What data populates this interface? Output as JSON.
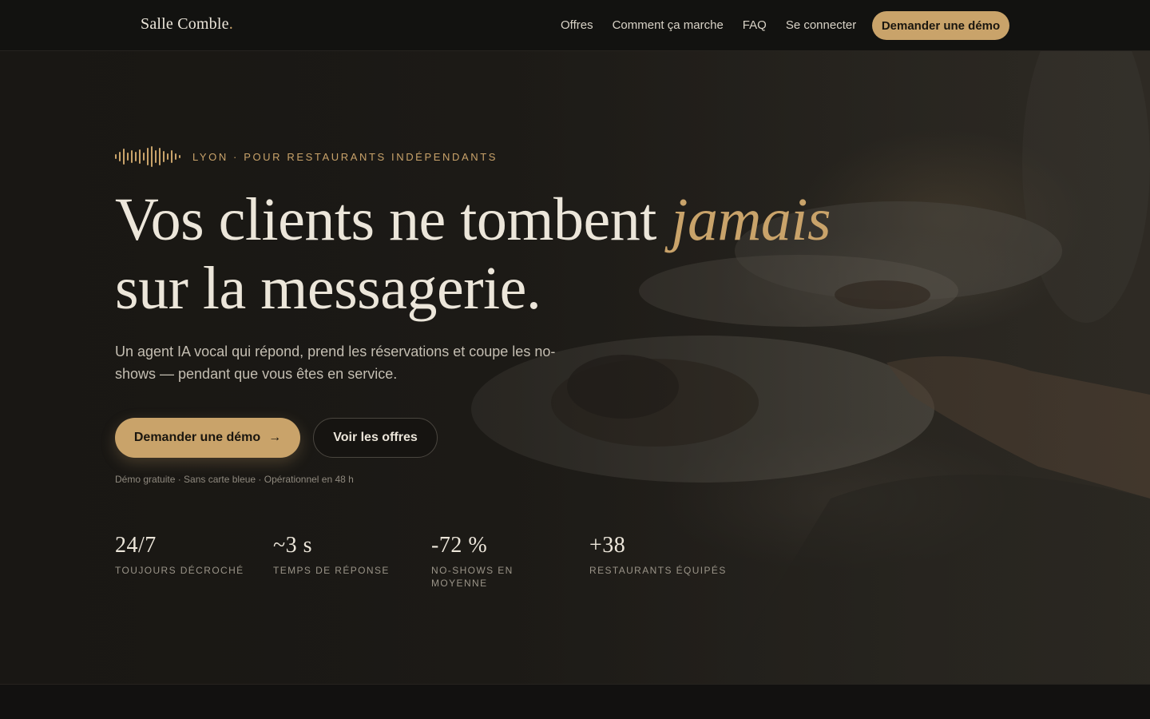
{
  "header": {
    "logo_text": "Salle Comble",
    "logo_dot": ".",
    "nav": [
      {
        "label": "Offres"
      },
      {
        "label": "Comment ça marche"
      },
      {
        "label": "FAQ"
      },
      {
        "label": "Se connecter"
      }
    ],
    "cta_label": "Demander une démo"
  },
  "hero": {
    "eyebrow": "LYON · POUR RESTAURANTS INDÉPENDANTS",
    "eyebrow_icon": "soundwave-icon",
    "headline_part1": "Vos clients ne tombent ",
    "headline_accent": "jamais",
    "headline_part2": "sur la messagerie.",
    "subtitle": "Un agent IA vocal qui répond, prend les réservations et coupe les no-shows — pendant que vous êtes en service.",
    "primary_cta": "Demander une démo",
    "primary_cta_icon": "arrow-right-icon",
    "secondary_cta": "Voir les offres",
    "footnote": "Démo gratuite · Sans carte bleue · Opérationnel en 48 h"
  },
  "stats": [
    {
      "value": "24/7",
      "label": "TOUJOURS DÉCROCHÉ"
    },
    {
      "value": "~3 s",
      "label": "TEMPS DE RÉPONSE"
    },
    {
      "value": "-72 %",
      "label": "NO-SHOWS EN MOYENNE"
    },
    {
      "value": "+38",
      "label": "RESTAURANTS ÉQUIPÉS"
    }
  ],
  "colors": {
    "accent": "#c9a36a",
    "background": "#121110",
    "text": "#ece6da"
  }
}
